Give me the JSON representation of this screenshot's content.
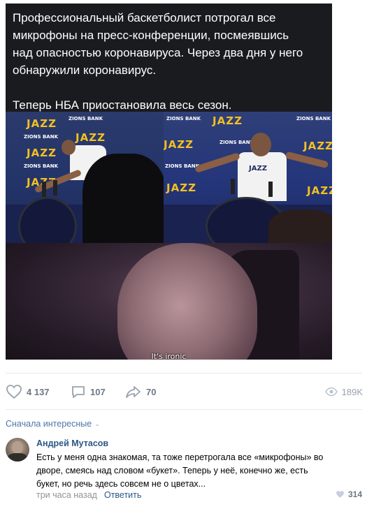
{
  "post": {
    "caption": "Профессиональный баскетболист потрогал все\nмикрофоны на пресс-конференции, посмеявшись\nнад опасностью коронавируса. Через два дня у него\nобнаружили коронавирус.\n\nТеперь НБА приостановила весь сезон.",
    "meme_subtitle": "It's ironic",
    "photo_brand": "JAZZ",
    "photo_sponsor": "ZIONS BANK",
    "photo_shirt": "JAZZ"
  },
  "actions": {
    "likes": "4 137",
    "comments": "107",
    "shares": "70",
    "views": "189K"
  },
  "comments_section": {
    "sort_label": "Сначала интересные",
    "items": [
      {
        "author": "Андрей Мутасов",
        "text": "Есть у меня одна знакомая, та тоже перетрогала все «микрофоны» во\nдворе, смеясь над словом «букет». Теперь у неё, конечно же, есть\nбукет, но речь здесь совсем не о цветах...",
        "time": "три часа назад",
        "reply_label": "Ответить",
        "likes": "314"
      }
    ]
  },
  "colors": {
    "link": "#2a5885",
    "accent": "#4a76a8",
    "icon_gray": "#818c99",
    "jazz_yellow": "#f3c021"
  },
  "icons": [
    "heart-icon",
    "comment-icon",
    "share-icon",
    "eye-icon",
    "chevron-down-icon"
  ]
}
